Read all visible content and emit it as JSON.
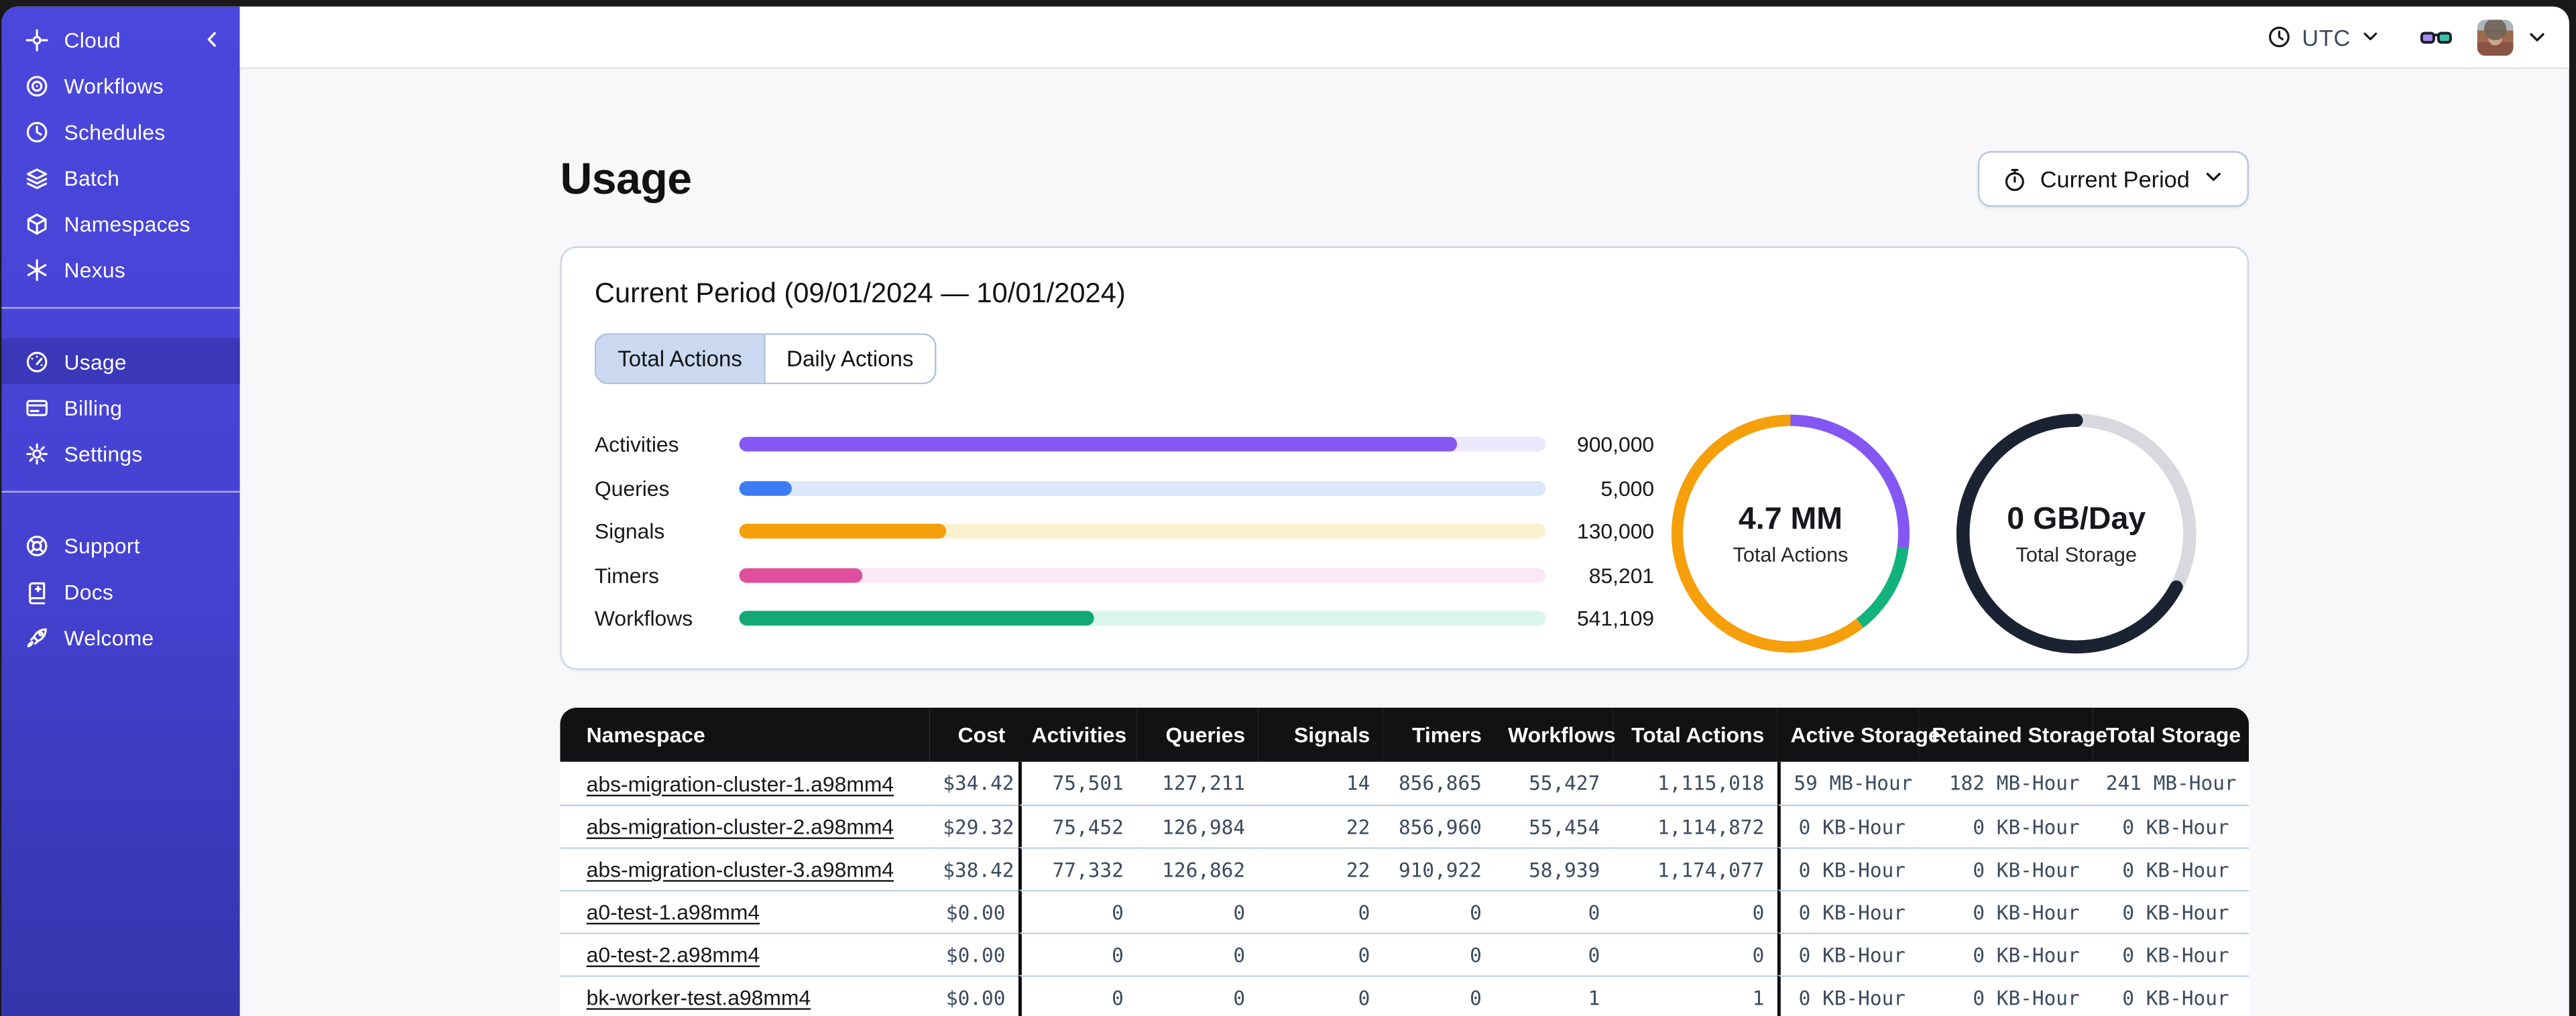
{
  "colors": {
    "desktop_bg": "#191919",
    "sidebar_top": "#4B47DD",
    "sidebar_bottom": "#3336AB",
    "sidebar_active": "#3B38B9",
    "table_header_bg": "#121214",
    "row_divider": "#C3D4E4",
    "card_border": "#CBD6E6",
    "tab_active_bg": "#CBD9F0"
  },
  "sidebar": {
    "brand": {
      "id": "cloud",
      "icon": "cloud",
      "label": "Cloud"
    },
    "sections": [
      {
        "items": [
          {
            "id": "workflows",
            "icon": "workflows",
            "label": "Workflows"
          },
          {
            "id": "schedules",
            "icon": "schedules",
            "label": "Schedules"
          },
          {
            "id": "batch",
            "icon": "batch",
            "label": "Batch"
          },
          {
            "id": "namespaces",
            "icon": "namespaces",
            "label": "Namespaces"
          },
          {
            "id": "nexus",
            "icon": "nexus",
            "label": "Nexus"
          }
        ]
      },
      {
        "items": [
          {
            "id": "usage",
            "icon": "usage",
            "label": "Usage",
            "active": true
          },
          {
            "id": "billing",
            "icon": "billing",
            "label": "Billing"
          },
          {
            "id": "settings",
            "icon": "settings",
            "label": "Settings"
          }
        ]
      },
      {
        "items": [
          {
            "id": "support",
            "icon": "support",
            "label": "Support"
          },
          {
            "id": "docs",
            "icon": "docs",
            "label": "Docs"
          },
          {
            "id": "welcome",
            "icon": "welcome",
            "label": "Welcome"
          }
        ]
      }
    ]
  },
  "topbar": {
    "timezone": "UTC"
  },
  "page": {
    "title": "Usage",
    "period_button_label": "Current Period"
  },
  "card": {
    "title": "Current Period (09/01/2024 — 10/01/2024)",
    "tabs": [
      {
        "label": "Total Actions",
        "active": true
      },
      {
        "label": "Daily Actions",
        "active": false
      }
    ],
    "bars": [
      {
        "label": "Activities",
        "value_label": "900,000",
        "pct": 89,
        "fill": "#8457F2",
        "track": "#EDE7FC"
      },
      {
        "label": "Queries",
        "value_label": "5,000",
        "pct": 6.6,
        "fill": "#3D7CF4",
        "track": "#DBE7FB"
      },
      {
        "label": "Signals",
        "value_label": "130,000",
        "pct": 25.7,
        "fill": "#F59F0A",
        "track": "#FCF1CF"
      },
      {
        "label": "Timers",
        "value_label": "85,201",
        "pct": 15.2,
        "fill": "#E04E9E",
        "track": "#FBE8F6"
      },
      {
        "label": "Workflows",
        "value_label": "541,109",
        "pct": 44,
        "fill": "#12A877",
        "track": "#D9F6EA"
      }
    ],
    "donuts": [
      {
        "value": "4.7 MM",
        "label": "Total Actions",
        "cap": "butt",
        "stroke": 7,
        "segments": [
          {
            "name": "activities",
            "color": "#8457F2",
            "pct": 27,
            "start": 0
          },
          {
            "name": "workflows",
            "color": "#12B27D",
            "pct": 12.5,
            "start": 27
          },
          {
            "name": "signals",
            "color": "#F59F0A",
            "pct": 60.5,
            "start": 39.5
          }
        ]
      },
      {
        "value": "0 GB/Day",
        "label": "Total Storage",
        "cap": "round",
        "stroke": 8,
        "track": "#D8D8DE",
        "segments": [
          {
            "name": "storage-used",
            "color": "#1B2333",
            "pct": 67.2,
            "start": 32.8
          }
        ]
      }
    ]
  },
  "table": {
    "columns": [
      {
        "label": "Namespace",
        "align": "left"
      },
      {
        "label": "Cost",
        "align": "right"
      },
      {
        "label": "Activities",
        "align": "right",
        "group_start": true
      },
      {
        "label": "Queries",
        "align": "right"
      },
      {
        "label": "Signals",
        "align": "right"
      },
      {
        "label": "Timers",
        "align": "right"
      },
      {
        "label": "Workflows",
        "align": "right"
      },
      {
        "label": "Total Actions",
        "align": "right"
      },
      {
        "label": "Active Storage",
        "align": "right",
        "group_start": true
      },
      {
        "label": "Retained Storage",
        "align": "right"
      },
      {
        "label": "Total Storage",
        "align": "right"
      }
    ],
    "rows": [
      [
        "abs-migration-cluster-1.a98mm4",
        "$34.42",
        "75,501",
        "127,211",
        "14",
        "856,865",
        "55,427",
        "1,115,018",
        "59 MB-Hour",
        "182 MB-Hour",
        "241 MB-Hour"
      ],
      [
        "abs-migration-cluster-2.a98mm4",
        "$29.32",
        "75,452",
        "126,984",
        "22",
        "856,960",
        "55,454",
        "1,114,872",
        "0 KB-Hour",
        "0 KB-Hour",
        "0 KB-Hour"
      ],
      [
        "abs-migration-cluster-3.a98mm4",
        "$38.42",
        "77,332",
        "126,862",
        "22",
        "910,922",
        "58,939",
        "1,174,077",
        "0 KB-Hour",
        "0 KB-Hour",
        "0 KB-Hour"
      ],
      [
        "a0-test-1.a98mm4",
        "$0.00",
        "0",
        "0",
        "0",
        "0",
        "0",
        "0",
        "0 KB-Hour",
        "0 KB-Hour",
        "0 KB-Hour"
      ],
      [
        "a0-test-2.a98mm4",
        "$0.00",
        "0",
        "0",
        "0",
        "0",
        "0",
        "0",
        "0 KB-Hour",
        "0 KB-Hour",
        "0 KB-Hour"
      ],
      [
        "bk-worker-test.a98mm4",
        "$0.00",
        "0",
        "0",
        "0",
        "0",
        "1",
        "1",
        "0 KB-Hour",
        "0 KB-Hour",
        "0 KB-Hour"
      ]
    ]
  }
}
